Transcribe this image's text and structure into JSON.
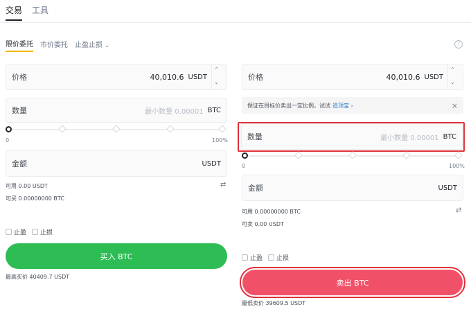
{
  "top_tabs": {
    "trade": "交易",
    "tools": "工具"
  },
  "order_tabs": {
    "limit": "限价委托",
    "market": "市价委托",
    "tpsl": "止盈止损"
  },
  "buy": {
    "price_label": "价格",
    "price_value": "40,010.6",
    "price_unit": "USDT",
    "amount_label": "数量",
    "amount_placeholder": "最小数量 0.00001",
    "amount_unit": "BTC",
    "slider_min": "0",
    "slider_max": "100%",
    "total_label": "金额",
    "total_unit": "USDT",
    "available": "可用 0.00 USDT",
    "can_buy": "可买 0.00000000 BTC",
    "take_profit": "止盈",
    "stop_loss": "止损",
    "button": "买入 BTC",
    "best_price": "最高买价 40409.7 USDT"
  },
  "sell": {
    "price_label": "价格",
    "price_value": "40,010.6",
    "price_unit": "USDT",
    "notice_text": "保证在目标价卖出一定比例，试试",
    "notice_link": "追顶宝",
    "amount_label": "数量",
    "amount_placeholder": "最小数量 0.00001",
    "amount_unit": "BTC",
    "slider_min": "0",
    "slider_max": "100%",
    "total_label": "金额",
    "total_unit": "USDT",
    "available": "可用 0.00000000 BTC",
    "can_sell": "可卖 0.00 USDT",
    "take_profit": "止盈",
    "stop_loss": "止损",
    "button": "卖出 BTC",
    "best_price": "最低卖价 39609.5 USDT"
  },
  "colors": {
    "buy": "#2ebd55",
    "sell": "#f05168",
    "highlight": "#e0303a",
    "accent": "#f0b90b"
  }
}
